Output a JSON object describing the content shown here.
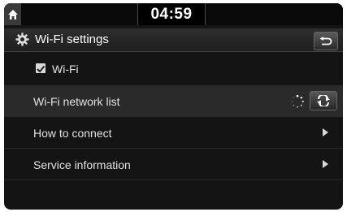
{
  "status_bar": {
    "clock": "04:59",
    "home_icon": "home-icon"
  },
  "header": {
    "title": "Wi-Fi settings",
    "settings_icon": "gear-icon",
    "back_icon": "back-arrow-icon"
  },
  "settings_list": {
    "wifi_toggle": {
      "label": "Wi-Fi",
      "checked": true
    },
    "network_list": {
      "label": "Wi-Fi network list",
      "loading": true,
      "refresh_icon": "refresh-icon"
    },
    "how_to_connect": {
      "label": "How to connect"
    },
    "service_information": {
      "label": "Service information"
    }
  },
  "colors": {
    "background": "#141414",
    "selected_row": "#2a2a2a",
    "text": "#e2e2e2"
  }
}
